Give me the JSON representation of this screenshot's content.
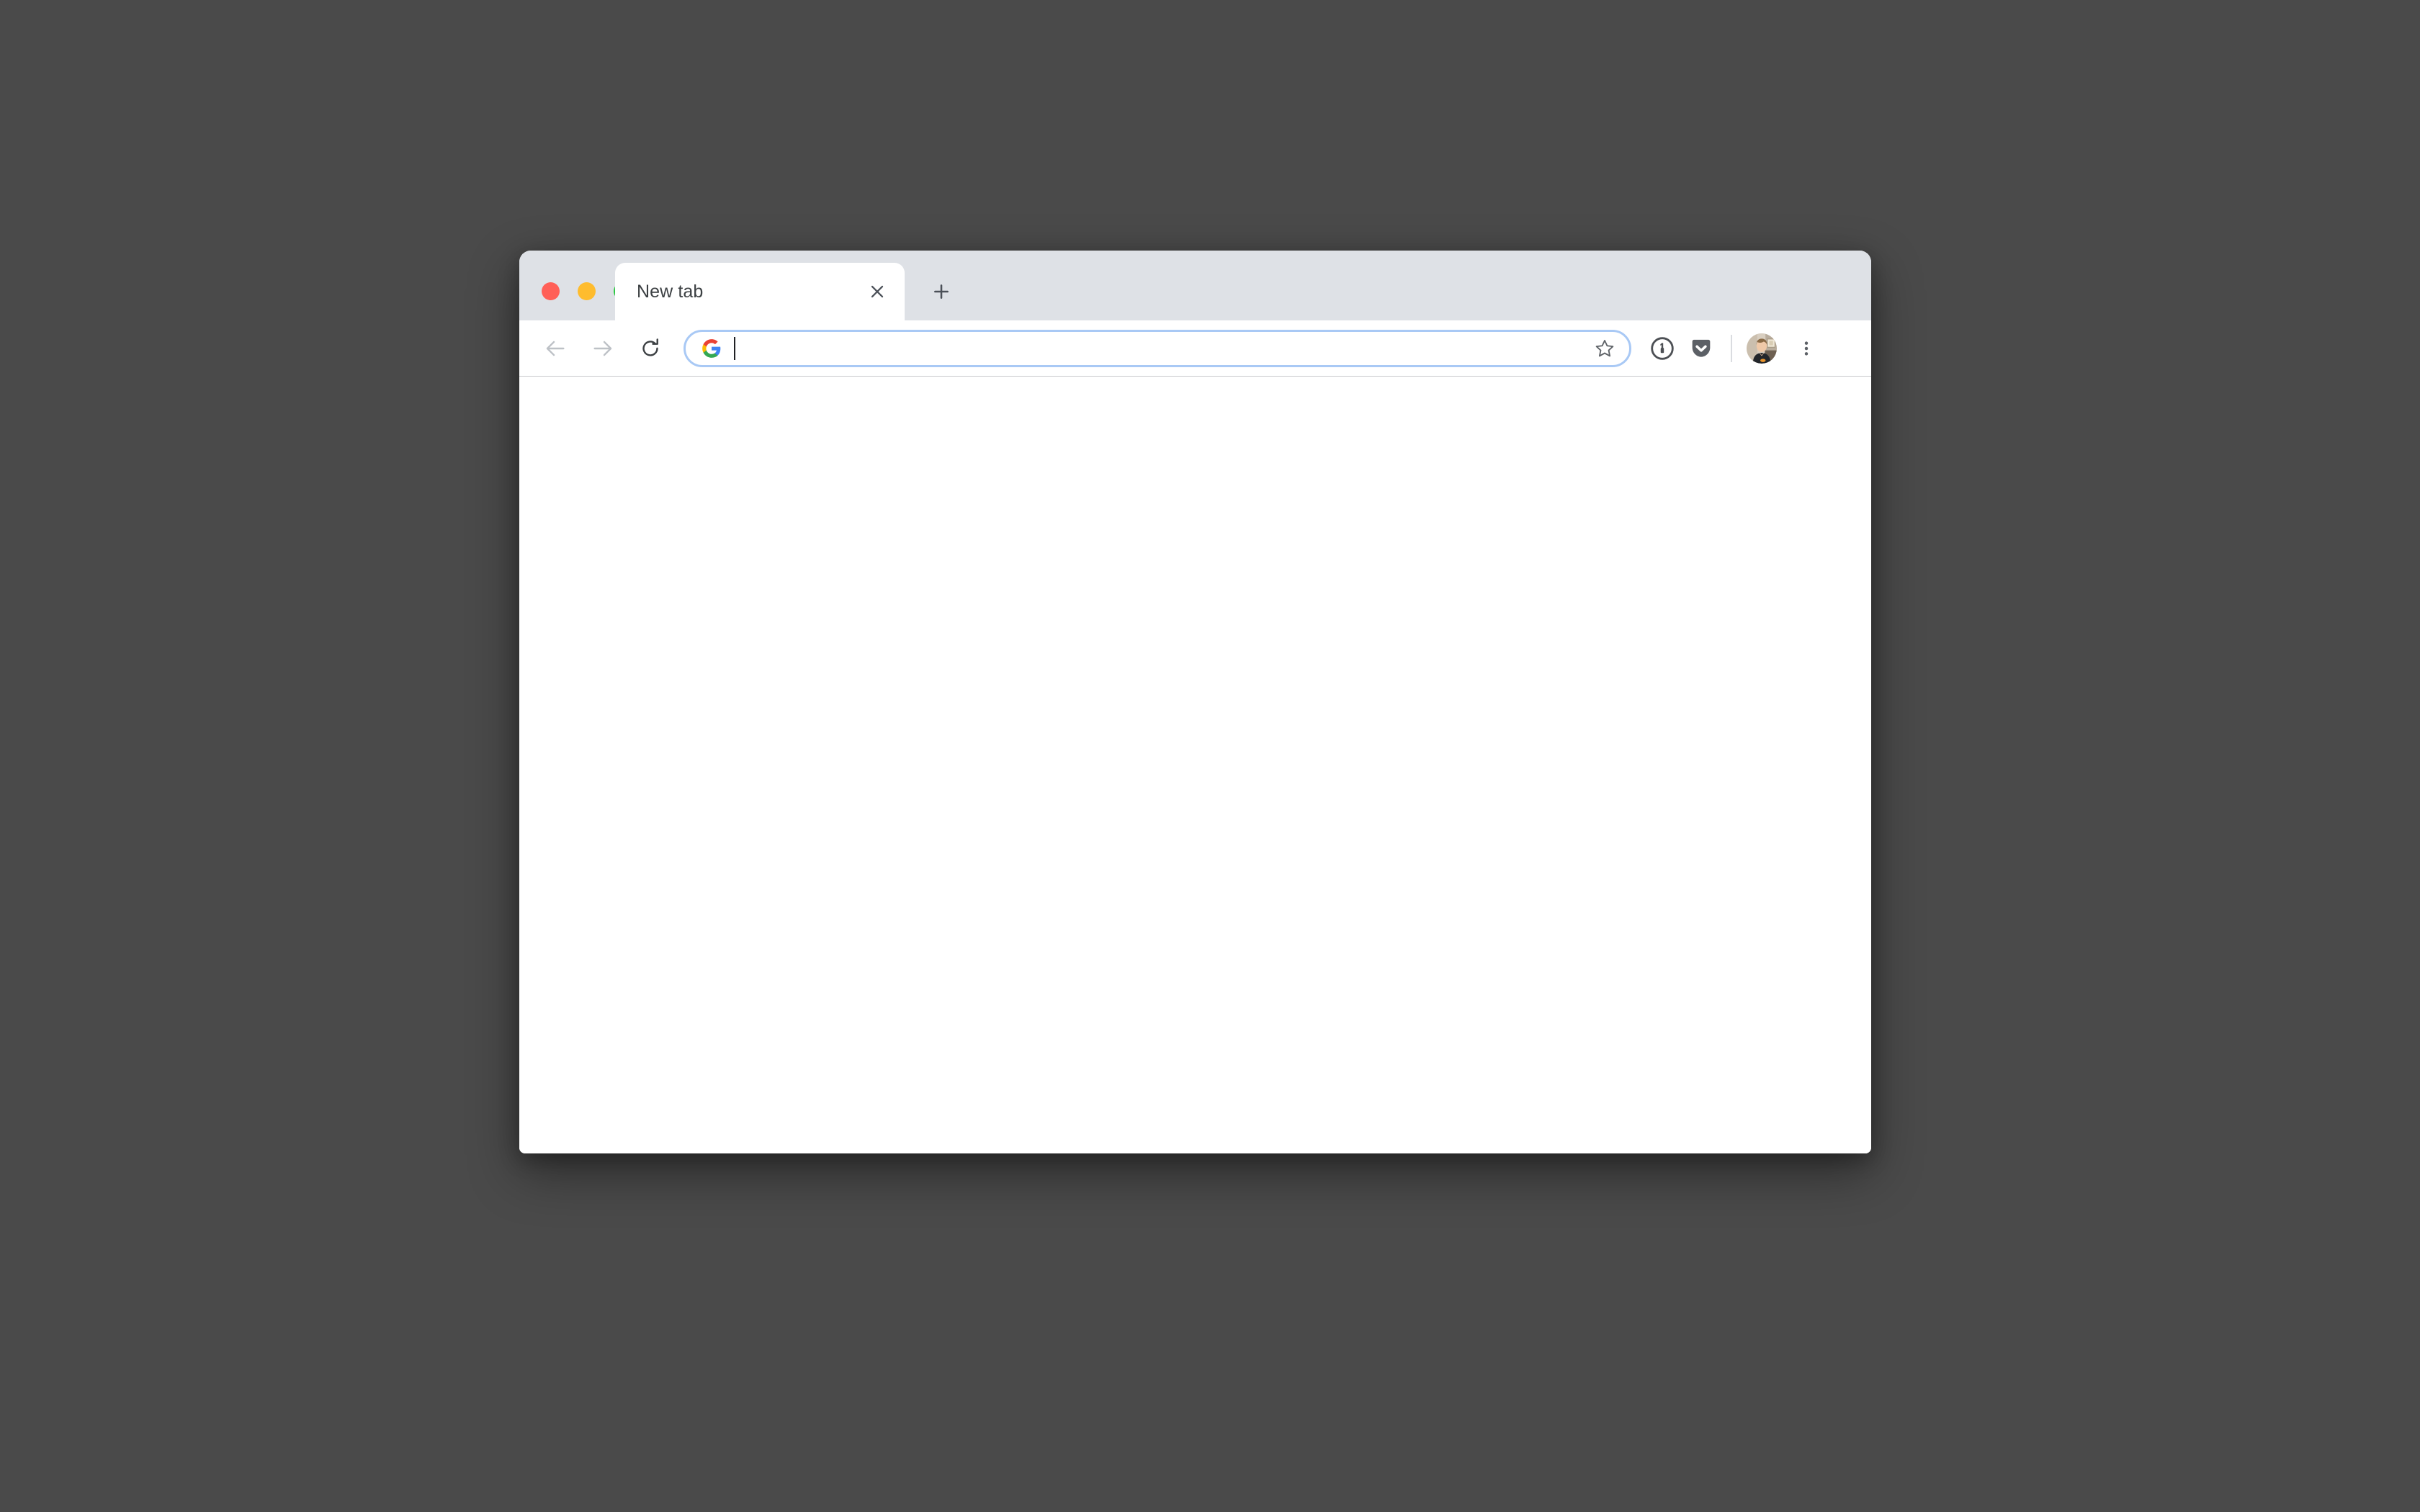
{
  "desktop": {
    "background_color": "#4a4a4a"
  },
  "window": {
    "title": "New tab",
    "tabstrip_background": "#dee1e6",
    "toolbar_background": "#ffffff",
    "content_background": "#ffffff"
  },
  "traffic_lights": [
    {
      "name": "close",
      "label": "Close",
      "color": "#ff5f57"
    },
    {
      "name": "minimize",
      "label": "Minimize",
      "color": "#febc2e"
    },
    {
      "name": "maximize",
      "label": "Maximize",
      "color": "#28c840"
    }
  ],
  "tabs": [
    {
      "label": "New tab",
      "active": true,
      "close_icon": "close-icon"
    }
  ],
  "new_tab_button": {
    "icon": "plus-icon",
    "tooltip": "New tab"
  },
  "navigation": {
    "back": {
      "icon": "arrow-left-icon",
      "enabled": false,
      "color": "#bdc1c6"
    },
    "forward": {
      "icon": "arrow-right-icon",
      "enabled": false,
      "color": "#bdc1c6"
    },
    "reload": {
      "icon": "reload-icon",
      "enabled": true,
      "color": "#3c4043"
    }
  },
  "omnibox": {
    "icon": "google-g-icon",
    "value": "",
    "placeholder": "",
    "focused": true,
    "caret_visible": true,
    "border_color": "#a9c9f5",
    "bookmark_icon": "star-outline-icon"
  },
  "toolbar_actions": [
    {
      "name": "onepassword-extension",
      "icon": "onepassword-icon",
      "label": "1Password",
      "color": "#5f6368"
    },
    {
      "name": "pocket-extension",
      "icon": "pocket-icon",
      "label": "Save to Pocket",
      "color": "#5f6368"
    }
  ],
  "profile": {
    "name": "profile-avatar",
    "label": "Profile"
  },
  "menu": {
    "icon": "three-dots-vertical-icon",
    "label": "Customize and control Google Chrome"
  },
  "page": {
    "body_text": ""
  }
}
